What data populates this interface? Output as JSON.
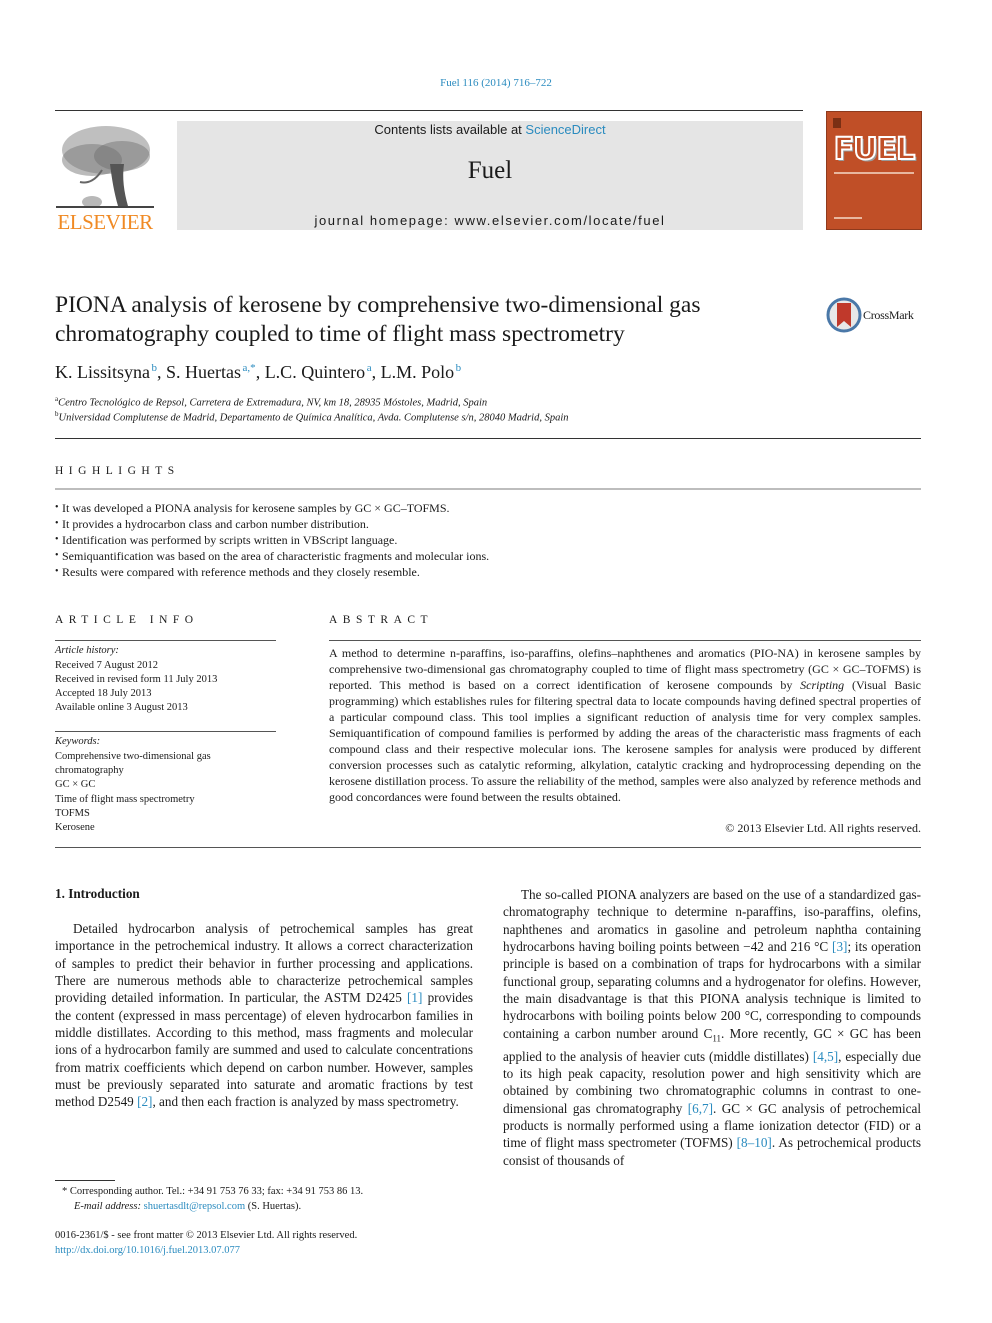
{
  "header": {
    "journal_ref": "Fuel 116 (2014) 716–722",
    "contents_prefix": "Contents lists available at ",
    "contents_link": "ScienceDirect",
    "journal_name": "Fuel",
    "homepage": "journal homepage: www.elsevier.com/locate/fuel",
    "publisher_logo_text": "ELSEVIER",
    "cover_title": "FUEL",
    "accent_color": "#2a8bbf",
    "publisher_color": "#f08a24",
    "cover_color": "#c04f27"
  },
  "article": {
    "title": "PIONA analysis of kerosene by comprehensive two-dimensional gas chromatography coupled to time of flight mass spectrometry",
    "crossmark_label": "CrossMark",
    "authors": [
      {
        "name": "K. Lissitsyna",
        "sup": "b"
      },
      {
        "name": "S. Huertas",
        "sup": "a,*"
      },
      {
        "name": "L.C. Quintero",
        "sup": "a"
      },
      {
        "name": "L.M. Polo",
        "sup": "b"
      }
    ],
    "affiliations": [
      {
        "sup": "a",
        "text": "Centro Tecnológico de Repsol, Carretera de Extremadura, NV, km 18, 28935 Móstoles, Madrid, Spain"
      },
      {
        "sup": "b",
        "text": "Universidad Complutense de Madrid, Departamento de Química Analítica, Avda. Complutense s/n, 28040 Madrid, Spain"
      }
    ]
  },
  "highlights": {
    "heading": "HIGHLIGHTS",
    "items": [
      "It was developed a PIONA analysis for kerosene samples by GC × GC–TOFMS.",
      "It provides a hydrocarbon class and carbon number distribution.",
      "Identification was performed by scripts written in VBScript language.",
      "Semiquantification was based on the area of characteristic fragments and molecular ions.",
      "Results were compared with reference methods and they closely resemble."
    ]
  },
  "article_info": {
    "heading": "ARTICLE INFO",
    "history_label": "Article history:",
    "history": [
      "Received 7 August 2012",
      "Received in revised form 11 July 2013",
      "Accepted 18 July 2013",
      "Available online 3 August 2013"
    ],
    "keywords_label": "Keywords:",
    "keywords": [
      "Comprehensive two-dimensional gas chromatography",
      "GC × GC",
      "Time of flight mass spectrometry",
      "TOFMS",
      "Kerosene"
    ]
  },
  "abstract": {
    "heading": "ABSTRACT",
    "text_before_italic": "A method to determine n-paraffins, iso-paraffins, olefins–naphthenes and aromatics (PIO-NA) in kerosene samples by comprehensive two-dimensional gas chromatography coupled to time of flight mass spectrometry (GC × GC–TOFMS) is reported. This method is based on a correct identification of kerosene compounds by ",
    "italic": "Scripting",
    "text_after_italic": " (Visual Basic programming) which establishes rules for filtering spectral data to locate compounds having defined spectral properties of a particular compound class. This tool implies a significant reduction of analysis time for very complex samples. Semiquantification of compound families is performed by adding the areas of the characteristic mass fragments of each compound class and their respective molecular ions. The kerosene samples for analysis were produced by different conversion processes such as catalytic reforming, alkylation, catalytic cracking and hydroprocessing depending on the kerosene distillation process. To assure the reliability of the method, samples were also analyzed by reference methods and good concordances were found between the results obtained.",
    "copyright": "© 2013 Elsevier Ltd. All rights reserved."
  },
  "body": {
    "section_heading": "1. Introduction",
    "left_p1": "Detailed hydrocarbon analysis of petrochemical samples has great importance in the petrochemical industry. It allows a correct characterization of samples to predict their behavior in further processing and applications. There are numerous methods able to characterize petrochemical samples providing detailed information. In particular, the ASTM D2425 ",
    "ref1": "[1]",
    "left_p2": " provides the content (expressed in mass percentage) of eleven hydrocarbon families in middle distillates. According to this method, mass fragments and molecular ions of a hydrocarbon family are summed and used to calculate concentrations from matrix coefficients which depend on carbon number. However, samples must be previously separated into saturate and aromatic fractions by test method D2549 ",
    "ref2": "[2]",
    "left_p3": ", and then each fraction is analyzed by mass spectrometry.",
    "right_s1": "The so-called PIONA analyzers are based on the use of a standardized gas-chromatography technique to determine n-paraffins, iso-paraffins, olefins, naphthenes and aromatics in gasoline and petroleum naphtha containing hydrocarbons having boiling points between −42 and 216 °C ",
    "ref3": "[3]",
    "right_s2": "; its operation principle is based on a combination of traps for hydrocarbons with a similar functional group, separating columns and a hydrogenator for olefins. However, the main disadvantage is that this PIONA analysis technique is limited to hydrocarbons with boiling points below 200 °C, corresponding to compounds containing a carbon number around C",
    "sub11": "11",
    "right_s3": ". More recently, GC × GC has been applied to the analysis of heavier cuts (middle distillates) ",
    "ref45": "[4,5]",
    "right_s4": ", especially due to its high peak capacity, resolution power and high sensitivity which are obtained by combining two chromatographic columns in contrast to one-dimensional gas chromatography ",
    "ref67": "[6,7]",
    "right_s5": ". GC × GC analysis of petrochemical products is normally performed using a flame ionization detector (FID) or a time of flight mass spectrometer (TOFMS) ",
    "ref810": "[8–10]",
    "right_s6": ". As petrochemical products consist of thousands of"
  },
  "footnotes": {
    "corresponding": "* Corresponding author. Tel.: +34 91 753 76 33; fax: +34 91 753 86 13.",
    "email_label": "E-mail address: ",
    "email": "shuertasdlt@repsol.com",
    "email_suffix": " (S. Huertas).",
    "issn": "0016-2361/$ - see front matter © 2013 Elsevier Ltd. All rights reserved.",
    "doi": "http://dx.doi.org/10.1016/j.fuel.2013.07.077"
  }
}
